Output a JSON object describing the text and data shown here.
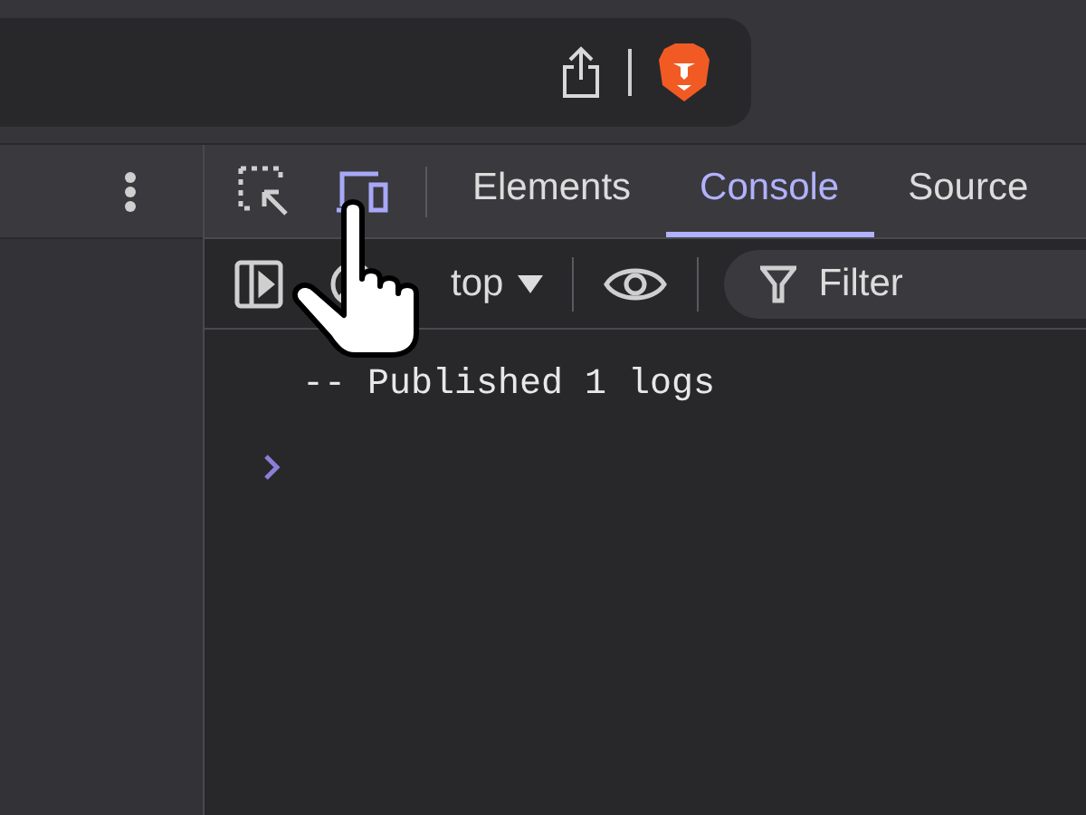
{
  "devtools": {
    "device_toolbar": {
      "on": true
    },
    "tabs": [
      {
        "label": "Elements",
        "selected": false
      },
      {
        "label": "Console",
        "selected": true
      },
      {
        "label": "Source",
        "selected": false
      }
    ],
    "context_selector": {
      "value": "top"
    },
    "filter": {
      "placeholder": "Filter"
    },
    "console": {
      "lines": [
        "-- Published 1 logs"
      ]
    }
  }
}
